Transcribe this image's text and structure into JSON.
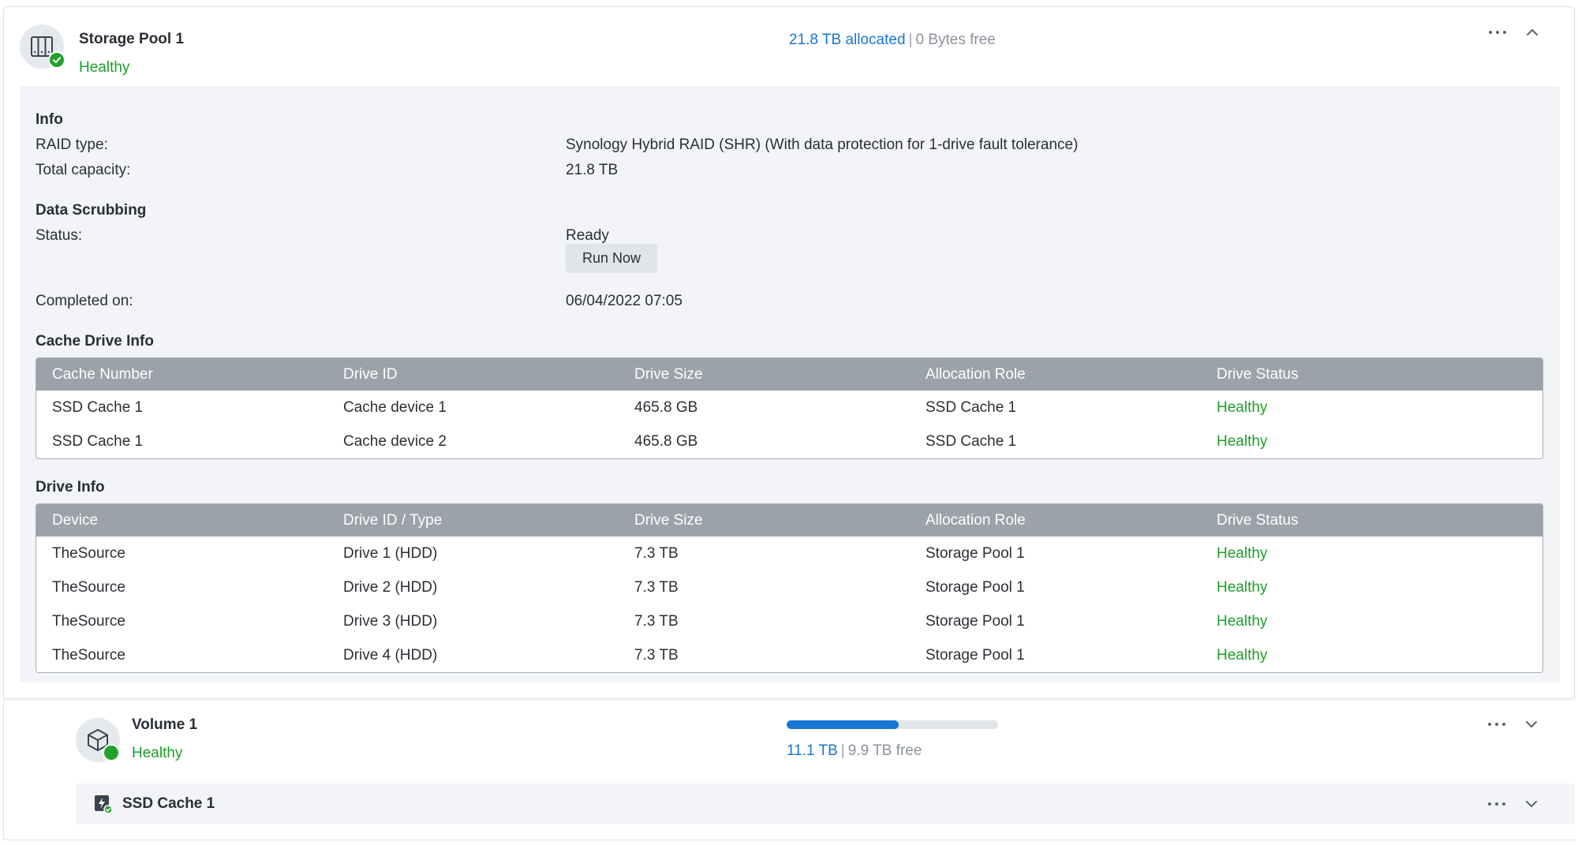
{
  "pool": {
    "title": "Storage Pool 1",
    "status": "Healthy",
    "allocated": "21.8 TB allocated",
    "separator": "|",
    "free": "0 Bytes free",
    "info_heading": "Info",
    "raid_label": "RAID type:",
    "raid_value": "Synology Hybrid RAID (SHR) (With data protection for 1-drive fault tolerance)",
    "capacity_label": "Total capacity:",
    "capacity_value": "21.8 TB",
    "scrub_heading": "Data Scrubbing",
    "scrub_status_label": "Status:",
    "scrub_status_value": "Ready",
    "run_now_label": "Run Now",
    "completed_label": "Completed on:",
    "completed_value": "06/04/2022 07:05",
    "cache_heading": "Cache Drive Info",
    "drive_heading": "Drive Info"
  },
  "cache_table": {
    "headers": [
      "Cache Number",
      "Drive ID",
      "Drive Size",
      "Allocation Role",
      "Drive Status"
    ],
    "rows": [
      [
        "SSD Cache 1",
        "Cache device 1",
        "465.8 GB",
        "SSD Cache 1",
        "Healthy"
      ],
      [
        "SSD Cache 1",
        "Cache device 2",
        "465.8 GB",
        "SSD Cache 1",
        "Healthy"
      ]
    ]
  },
  "drive_table": {
    "headers": [
      "Device",
      "Drive ID / Type",
      "Drive Size",
      "Allocation Role",
      "Drive Status"
    ],
    "rows": [
      [
        "TheSource",
        "Drive 1 (HDD)",
        "7.3 TB",
        "Storage Pool 1",
        "Healthy"
      ],
      [
        "TheSource",
        "Drive 2 (HDD)",
        "7.3 TB",
        "Storage Pool 1",
        "Healthy"
      ],
      [
        "TheSource",
        "Drive 3 (HDD)",
        "7.3 TB",
        "Storage Pool 1",
        "Healthy"
      ],
      [
        "TheSource",
        "Drive 4 (HDD)",
        "7.3 TB",
        "Storage Pool 1",
        "Healthy"
      ]
    ]
  },
  "volume": {
    "title": "Volume 1",
    "status": "Healthy",
    "used": "11.1 TB",
    "separator": "|",
    "free": "9.9 TB free",
    "usage_fraction": 0.53
  },
  "ssd_cache": {
    "title": "SSD Cache 1"
  },
  "colors": {
    "accent": "#1876d3",
    "healthy": "#1e9e2a",
    "table_header": "#9ca2a9"
  },
  "icons": [
    "storage-pool-icon",
    "check-badge-icon",
    "more-icon",
    "chevron-up-icon",
    "chevron-down-icon",
    "volume-cube-icon",
    "ssd-cache-icon"
  ]
}
